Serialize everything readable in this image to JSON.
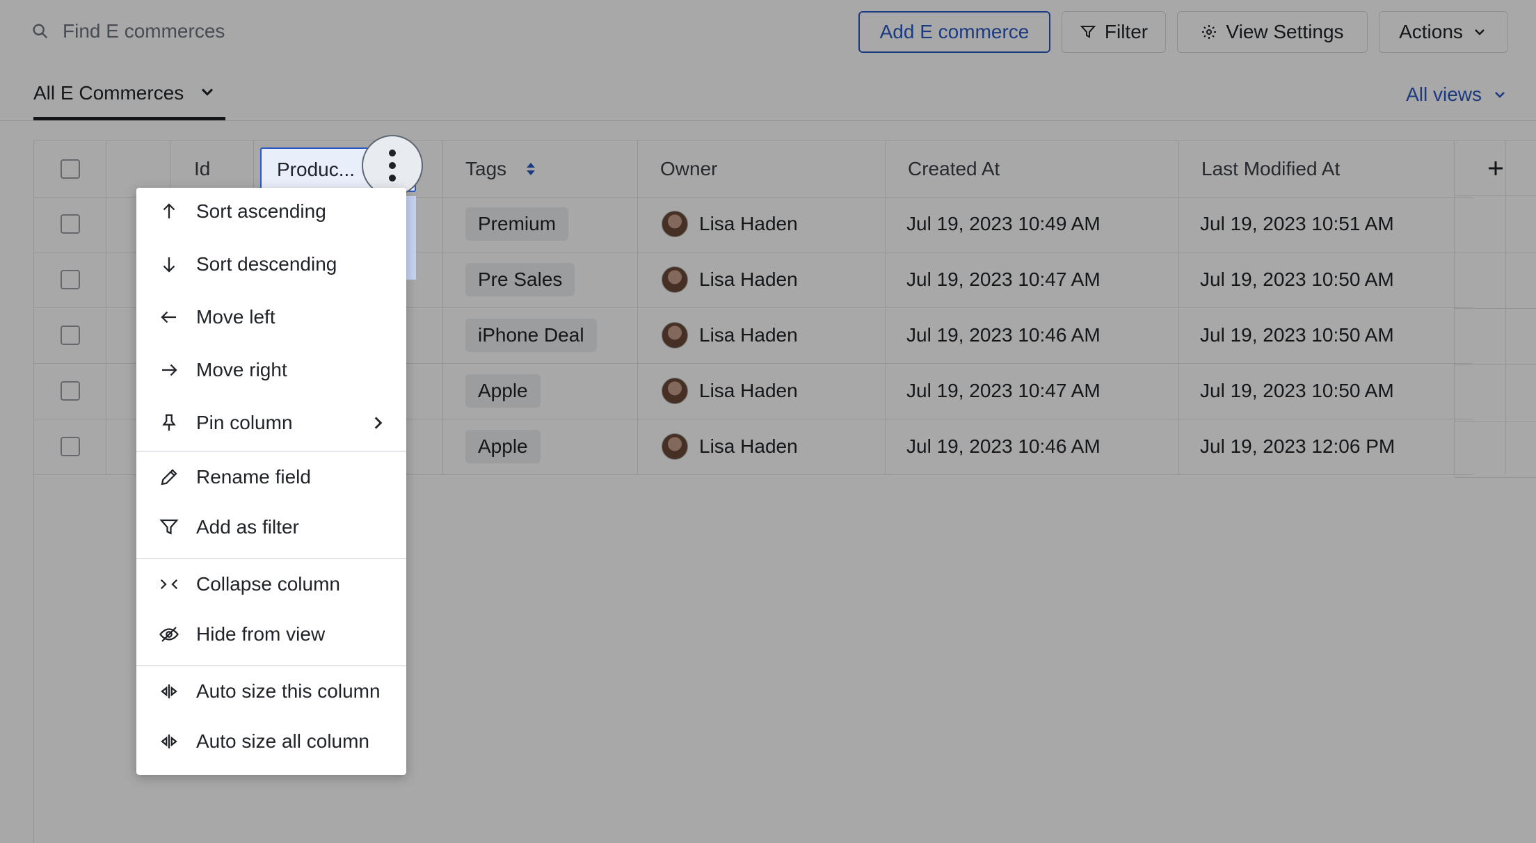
{
  "toolbar": {
    "search_placeholder": "Find E commerces",
    "add_label": "Add E commerce",
    "filter_label": "Filter",
    "view_settings_label": "View Settings",
    "actions_label": "Actions"
  },
  "views": {
    "current": "All E Commerces",
    "all_views_label": "All views"
  },
  "table": {
    "headers": {
      "id": "Id",
      "product": "Produc...",
      "tags": "Tags",
      "owner": "Owner",
      "created": "Created At",
      "modified": "Last Modified At"
    },
    "rows": [
      {
        "tag": "Premium",
        "owner": "Lisa Haden",
        "created": "Jul 19, 2023 10:49 AM",
        "modified": "Jul 19, 2023 10:51 AM"
      },
      {
        "tag": "Pre Sales",
        "owner": "Lisa Haden",
        "created": "Jul 19, 2023 10:47 AM",
        "modified": "Jul 19, 2023 10:50 AM"
      },
      {
        "tag": "iPhone Deal",
        "owner": "Lisa Haden",
        "created": "Jul 19, 2023 10:46 AM",
        "modified": "Jul 19, 2023 10:50 AM"
      },
      {
        "tag": "Apple",
        "owner": "Lisa Haden",
        "created": "Jul 19, 2023 10:47 AM",
        "modified": "Jul 19, 2023 10:50 AM"
      },
      {
        "tag": "Apple",
        "owner": "Lisa Haden",
        "created": "Jul 19, 2023 10:46 AM",
        "modified": "Jul 19, 2023 12:06 PM"
      }
    ]
  },
  "menu": {
    "sort_ascending": "Sort ascending",
    "sort_descending": "Sort descending",
    "move_left": "Move left",
    "move_right": "Move right",
    "pin_column": "Pin column",
    "rename_field": "Rename field",
    "add_as_filter": "Add as filter",
    "collapse_column": "Collapse column",
    "hide_from_view": "Hide from view",
    "auto_size_this": "Auto size this column",
    "auto_size_all": "Auto size all column"
  },
  "colors": {
    "accent": "#2b59c3",
    "overlay": "rgba(0,0,0,0.34)"
  }
}
